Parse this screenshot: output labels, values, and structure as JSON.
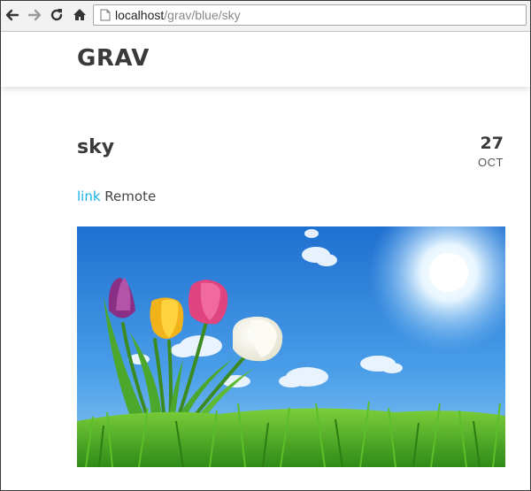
{
  "browser": {
    "url_host": "localhost",
    "url_path": "/grav/blue/sky"
  },
  "site": {
    "logo": "GRAV"
  },
  "post": {
    "title": "sky",
    "date_day": "27",
    "date_month": "OCT",
    "link_text": "link",
    "body_text": " Remote",
    "image_subject": "tulips-in-grass-under-blue-sky"
  },
  "colors": {
    "link": "#1bb3e8",
    "text": "#3a3a3a"
  }
}
